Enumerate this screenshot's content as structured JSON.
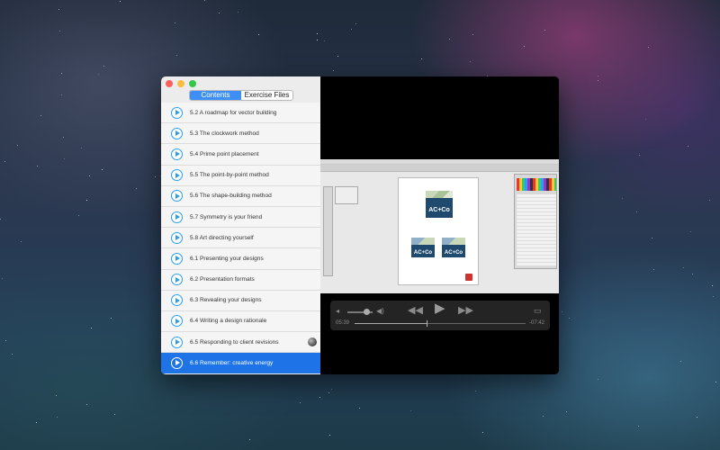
{
  "sidebar": {
    "tabs": [
      {
        "label": "Contents",
        "active": true
      },
      {
        "label": "Exercise Files",
        "active": false
      }
    ],
    "items": [
      {
        "label": "5.2 A roadmap for vector building"
      },
      {
        "label": "5.3 The clockwork method"
      },
      {
        "label": "5.4 Prime point placement"
      },
      {
        "label": "5.5 The point-by-point method"
      },
      {
        "label": "5.6 The shape-building method"
      },
      {
        "label": "5.7 Symmetry is your friend"
      },
      {
        "label": "5.8 Art directing yourself"
      },
      {
        "label": "6.1 Presenting your designs"
      },
      {
        "label": "6.2 Presentation formats"
      },
      {
        "label": "6.3 Revealing your designs"
      },
      {
        "label": "6.4 Writing a design rationale"
      },
      {
        "label": "6.5 Responding to client revisions"
      },
      {
        "label": "6.6 Remember: creative energy"
      }
    ],
    "selected_index": 12,
    "in_progress_index": 11
  },
  "video": {
    "logos": [
      "AC+Co",
      "AC+Co",
      "AC+Co"
    ]
  },
  "player": {
    "current_time": "05:39",
    "remaining_time": "-07:42",
    "progress": 0.42,
    "volume": 0.75,
    "icons": {
      "volume_low": "speaker-low-icon",
      "volume_high": "speaker-high-icon",
      "rewind": "rewind-icon",
      "play": "play-icon",
      "fast_forward": "fast-forward-icon",
      "airplay": "airplay-icon"
    }
  },
  "colors": {
    "accent": "#1e74e6",
    "play_icon": "#2b9ee8"
  }
}
